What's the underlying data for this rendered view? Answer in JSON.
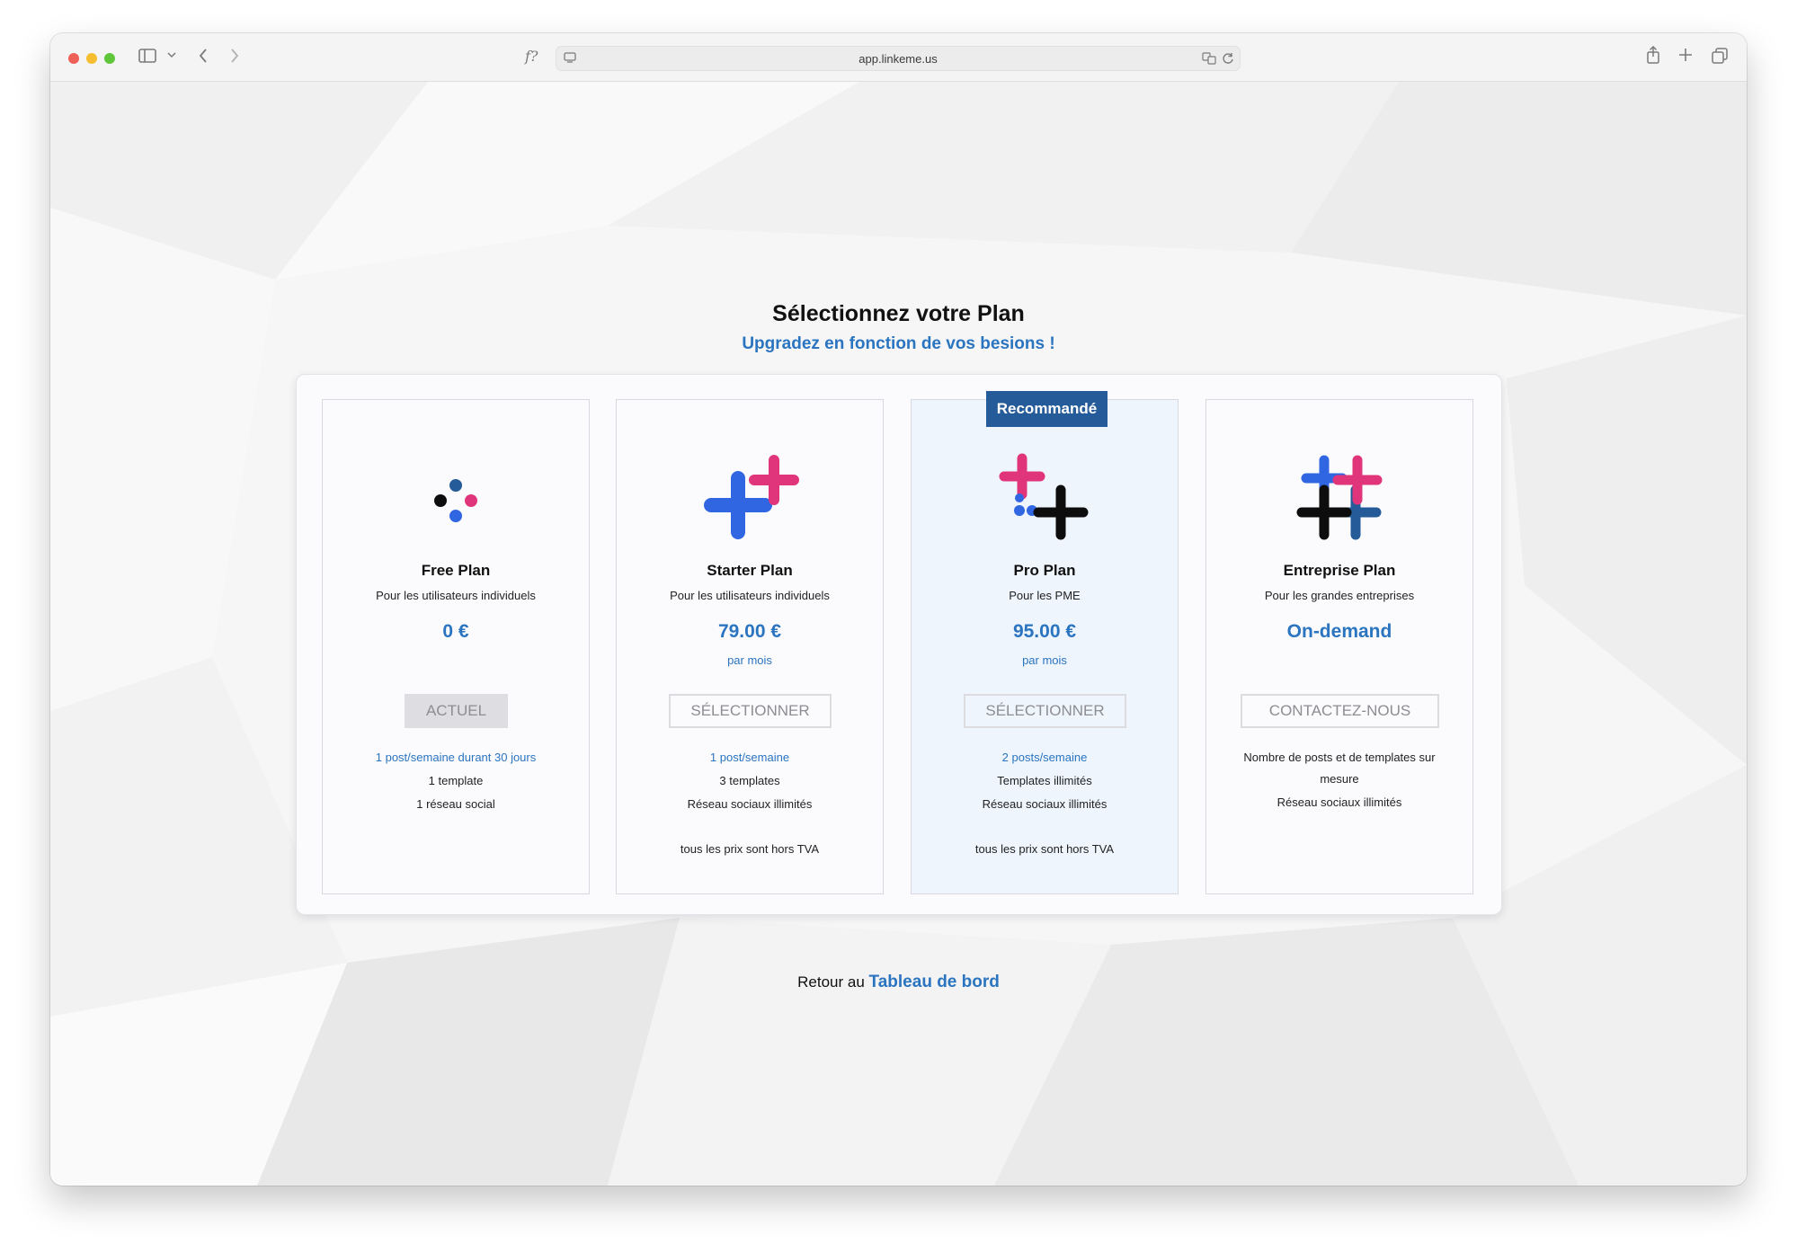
{
  "browser": {
    "url": "app.linkeme.us",
    "reader_label": "f?"
  },
  "colors": {
    "accent": "#2a74c0",
    "badge": "#245b98",
    "pink": "#e0357b",
    "blue": "#3166e3",
    "dark": "#0d0d0d"
  },
  "page": {
    "title": "Sélectionnez votre Plan",
    "subtitle": "Upgradez en fonction de vos besions !"
  },
  "plans": [
    {
      "name": "Free Plan",
      "desc": "Pour les utilisateurs individuels",
      "price": "0 €",
      "period": "",
      "button": "ACTUEL",
      "features": [
        "1 post/semaine durant 30 jours",
        "1 template",
        "1 réseau social"
      ],
      "note": ""
    },
    {
      "name": "Starter Plan",
      "desc": "Pour les utilisateurs individuels",
      "price": "79.00 €",
      "period": "par mois",
      "button": "SÉLECTIONNER",
      "features": [
        "1 post/semaine",
        "3 templates",
        "Réseau sociaux illimités"
      ],
      "note": "tous les prix sont hors TVA"
    },
    {
      "name": "Pro Plan",
      "badge": "Recommandé",
      "desc": "Pour les PME",
      "price": "95.00 €",
      "period": "par mois",
      "button": "SÉLECTIONNER",
      "features": [
        "2 posts/semaine",
        "Templates illimités",
        "Réseau sociaux illimités"
      ],
      "note": "tous les prix sont hors TVA"
    },
    {
      "name": "Entreprise Plan",
      "desc": "Pour les grandes entreprises",
      "price": "On-demand",
      "period": "",
      "button": "CONTACTEZ-NOUS",
      "features": [
        "Nombre de posts et de templates sur",
        "mesure",
        "Réseau sociaux illimités"
      ],
      "note": ""
    }
  ],
  "footer": {
    "prefix": "Retour au",
    "link": "Tableau de bord"
  }
}
